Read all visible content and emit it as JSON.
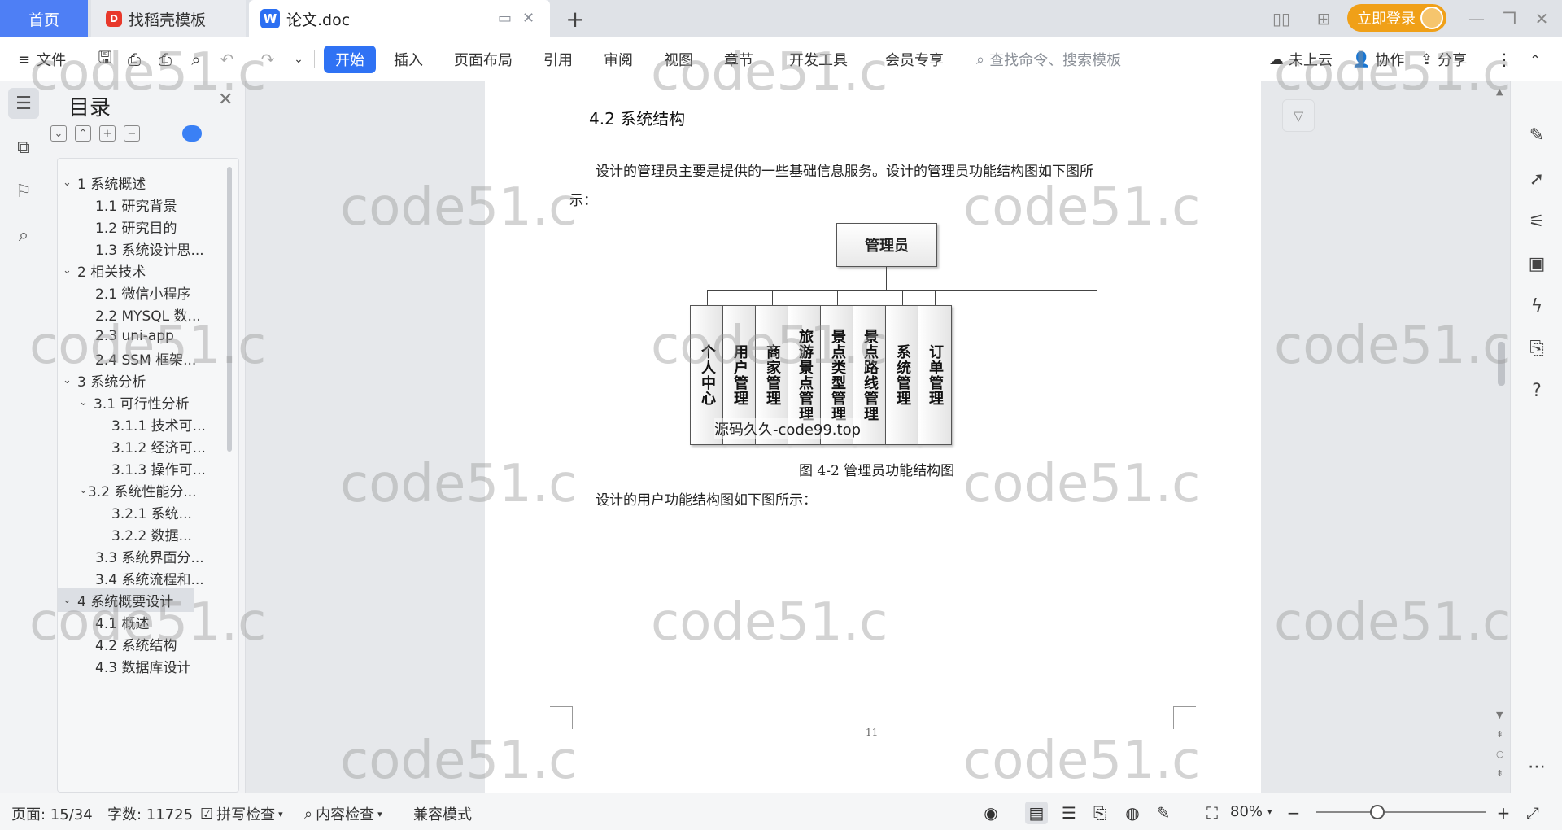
{
  "tabs": {
    "home": "首页",
    "daoke": "找稻壳模板",
    "doc": "论文.doc",
    "login": "立即登录"
  },
  "ribbon": {
    "file": "文件",
    "menus": [
      "开始",
      "插入",
      "页面布局",
      "引用",
      "审阅",
      "视图",
      "章节",
      "开发工具",
      "会员专享"
    ],
    "search_placeholder": "查找命令、搜索模板",
    "cloud": "未上云",
    "collab": "协作",
    "share": "分享"
  },
  "toc": {
    "title": "目录",
    "items": [
      {
        "label": "1 系统概述",
        "level": 1,
        "expanded": true
      },
      {
        "label": "1.1  研究背景",
        "level": 2
      },
      {
        "label": "1.2 研究目的",
        "level": 2
      },
      {
        "label": "1.3 系统设计思...",
        "level": 2
      },
      {
        "label": "2 相关技术",
        "level": 1,
        "expanded": true
      },
      {
        "label": "2.1 微信小程序",
        "level": 2
      },
      {
        "label": "2.2 MYSQL 数...",
        "level": 2
      },
      {
        "label": "2.3 uni-app",
        "level": 2
      },
      {
        "label": "2.4 SSM 框架...",
        "level": 2
      },
      {
        "label": "3 系统分析",
        "level": 1,
        "expanded": true
      },
      {
        "label": "3.1 可行性分析",
        "level": 2,
        "expanded": true
      },
      {
        "label": "3.1.1 技术可...",
        "level": 3
      },
      {
        "label": "3.1.2 经济可...",
        "level": 3
      },
      {
        "label": "3.1.3 操作可...",
        "level": 3
      },
      {
        "label": "3.2 系统性能分...",
        "level": 2,
        "expanded": true
      },
      {
        "label": "3.2.1  系统...",
        "level": 3
      },
      {
        "label": "3.2.2  数据...",
        "level": 3
      },
      {
        "label": "3.3 系统界面分...",
        "level": 2
      },
      {
        "label": "3.4 系统流程和...",
        "level": 2
      },
      {
        "label": "4 系统概要设计",
        "level": 1,
        "expanded": true,
        "selected": true
      },
      {
        "label": "4.1 概述",
        "level": 2
      },
      {
        "label": "4.2 系统结构",
        "level": 2
      },
      {
        "label": "4.3 数据库设计",
        "level": 2
      }
    ]
  },
  "document": {
    "heading": "4.2 系统结构",
    "para1_line1": "设计的管理员主要是提供的一些基础信息服务。设计的管理员功能结构图如下图所",
    "para1_line2": "示：",
    "org_root": "管理员",
    "org_children": [
      "个人中心",
      "用户管理",
      "商家管理",
      "旅游景点管理",
      "景点类型管理",
      "景点路线管理",
      "系统管理",
      "订单管理"
    ],
    "source_watermark": "源码久久-code99.top",
    "caption": "图 4-2 管理员功能结构图",
    "para2": "设计的用户功能结构图如下图所示：",
    "page_number": "11"
  },
  "status": {
    "page": "页面: 15/34",
    "words": "字数: 11725",
    "spell": "拼写检查",
    "content_check": "内容检查",
    "compat": "兼容模式",
    "zoom": "80%"
  },
  "watermark": "code51.c"
}
